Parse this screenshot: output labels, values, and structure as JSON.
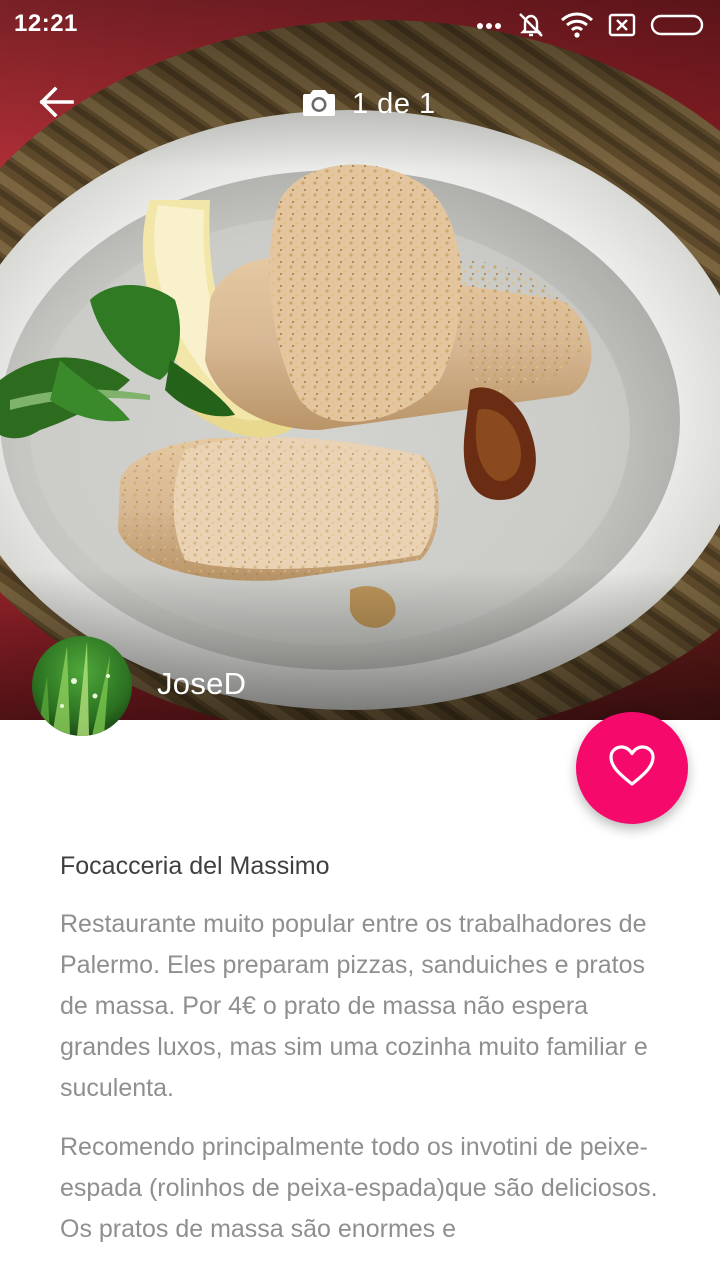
{
  "status_bar": {
    "time": "12:21",
    "icons": [
      "more-dots-icon",
      "silent-mode-icon",
      "wifi-icon",
      "sim-error-icon",
      "battery-icon"
    ]
  },
  "top_bar": {
    "back_icon": "arrow-back-icon",
    "camera_icon": "camera-icon",
    "photo_counter": "1 de 1"
  },
  "author": {
    "name": "JoseD",
    "avatar": "grass-avatar"
  },
  "favorite": {
    "icon": "heart-outline-icon",
    "color": "#f50a6c"
  },
  "place": {
    "title": "Focacceria del Massimo",
    "paragraphs": [
      "Restaurante muito popular entre os trabalhadores de Palermo. Eles preparam pizzas, sanduiches e pratos de massa. Por 4€ o prato de massa não espera grandes luxos, mas sim uma cozinha muito familiar e suculenta.",
      "Recomendo principalmente todo os invotini de peixe-espada (rolinhos de peixa-espada)que são deliciosos. Os pratos de massa são enormes e"
    ]
  }
}
